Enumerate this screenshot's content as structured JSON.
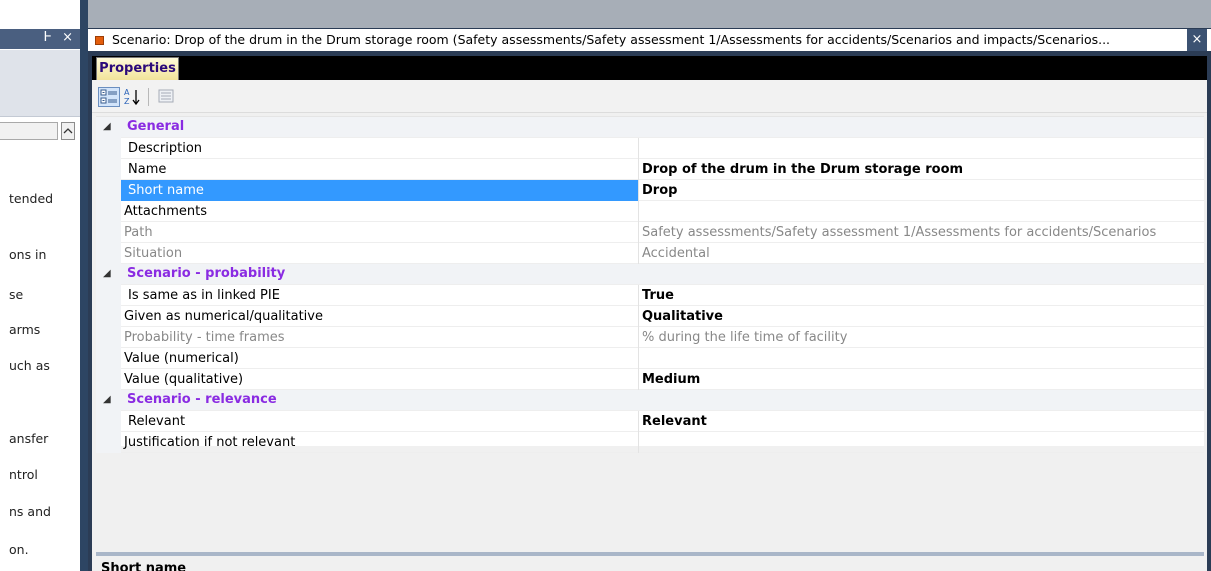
{
  "left_pane": {
    "title_buttons": "Ͱ ×",
    "text_fragments": [
      "tended",
      "ons in",
      "se",
      "arms",
      "uch as",
      "ansfer",
      "ntrol",
      "ns and",
      "on."
    ]
  },
  "document_tab": {
    "title": "Scenario: Drop of the drum in the Drum storage room  (Safety assessments/Safety assessment 1/Assessments for accidents/Scenarios and impacts/Scenarios...",
    "close_glyph": "×"
  },
  "properties_tab": {
    "label": "Properties"
  },
  "toolbar": {
    "categorized_icon": "categorized-view-icon",
    "alphabetical_icon": "sort-alphabetical-icon",
    "property_pages_icon": "property-pages-icon"
  },
  "grid": {
    "categories": [
      {
        "label": "General",
        "rows": [
          {
            "name": "Description",
            "value": ""
          },
          {
            "name": "Name",
            "value": "Drop of the drum in the Drum storage room"
          },
          {
            "name": "Short name",
            "value": "Drop"
          },
          {
            "name": "Attachments",
            "value": ""
          },
          {
            "name": "Path",
            "value": "Safety assessments/Safety assessment 1/Assessments for accidents/Scenarios"
          },
          {
            "name": "Situation",
            "value": "Accidental"
          }
        ]
      },
      {
        "label": "Scenario - probability",
        "rows": [
          {
            "name": "Is same as in linked PIE",
            "value": "True"
          },
          {
            "name": "Given as numerical/qualitative",
            "value": "Qualitative"
          },
          {
            "name": "Probability - time frames",
            "value": "% during the life time of facility"
          },
          {
            "name": "Value (numerical)",
            "value": ""
          },
          {
            "name": "Value (qualitative)",
            "value": "Medium"
          }
        ]
      },
      {
        "label": "Scenario - relevance",
        "rows": [
          {
            "name": "Relevant",
            "value": "Relevant"
          },
          {
            "name": "Justification if not relevant",
            "value": ""
          }
        ]
      }
    ]
  },
  "description_pane": {
    "title": "Short name"
  },
  "colors": {
    "category_text": "#8a2be2",
    "selection": "#3399ff",
    "frame": "#2b3c55",
    "tab_icon": "#e35d0c"
  }
}
